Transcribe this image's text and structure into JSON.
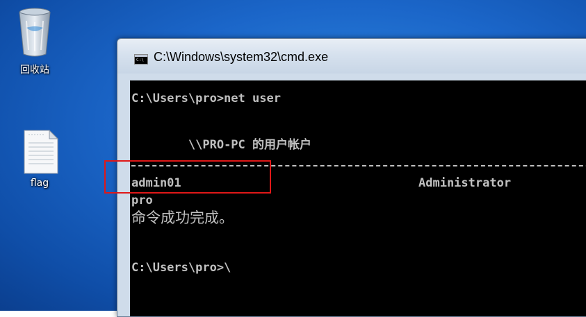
{
  "desktop": {
    "icons": [
      {
        "label": "回收站",
        "icon": "recycle-bin-icon"
      },
      {
        "label": "flag",
        "icon": "text-file-icon"
      }
    ],
    "background_color": "#1b66c9"
  },
  "cmd_window": {
    "title": "C:\\Windows\\system32\\cmd.exe",
    "console_bg": "#000000",
    "console_fg": "#c0c0c0",
    "lines": {
      "command": "C:\\Users\\pro>net user",
      "accounts_header": "\\\\PRO-PC 的用户帐户",
      "separator": "-------------------------------------------------------------------------------",
      "user_admin01": "admin01",
      "user_administrator": "Administrator",
      "user_pro": "pro",
      "success": "命令成功完成。",
      "prompt": "C:\\Users\\pro>\\"
    }
  },
  "annotation": {
    "color": "#e01818"
  }
}
